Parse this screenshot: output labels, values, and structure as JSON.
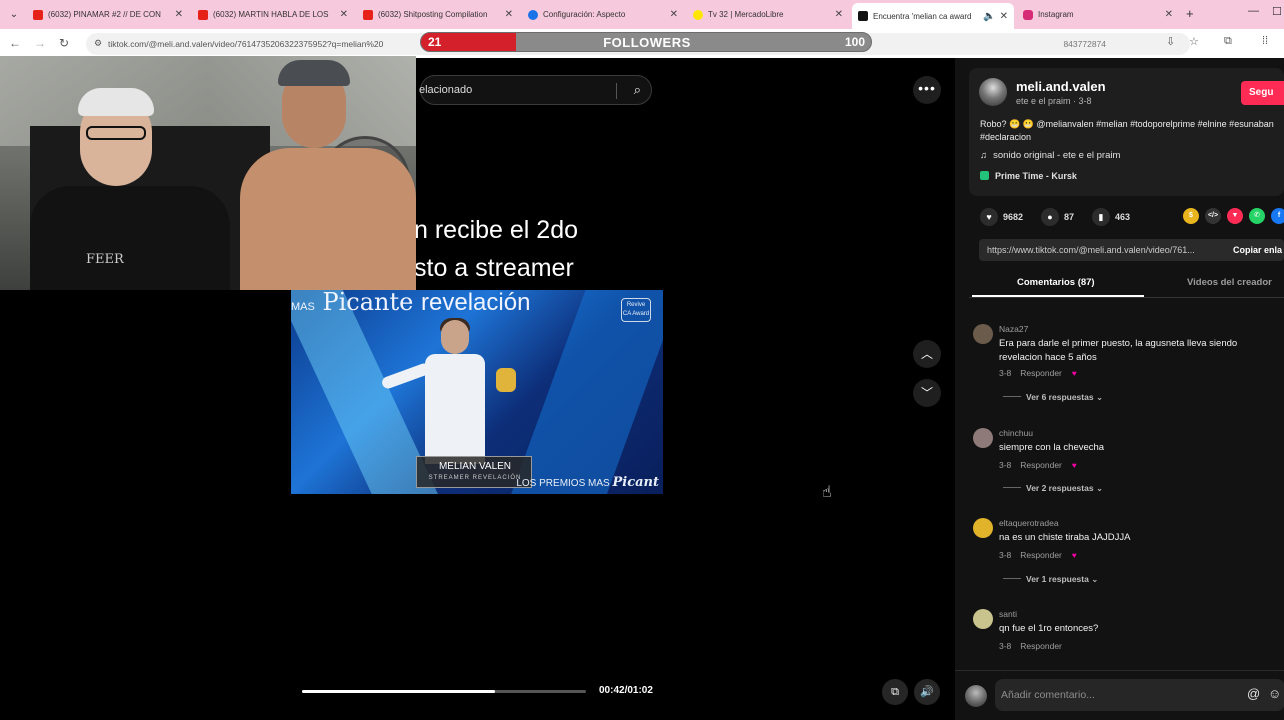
{
  "browser": {
    "tabs": [
      {
        "title": "(6032) PINAMAR #2 // DE CON",
        "icon": "youtube-icon",
        "color": "#e62117"
      },
      {
        "title": "(6032) MARTIN HABLA DE LOS",
        "icon": "youtube-icon",
        "color": "#e62117"
      },
      {
        "title": "(6032) Shitposting Compilation",
        "icon": "youtube-icon",
        "color": "#e62117"
      },
      {
        "title": "Configuración: Aspecto",
        "icon": "gear-icon",
        "color": "#1a73e8"
      },
      {
        "title": "Tv 32 | MercadoLibre",
        "icon": "mercadolibre-icon",
        "color": "#ffe600"
      },
      {
        "title": "Encuentra 'melian ca award",
        "icon": "tiktok-icon",
        "color": "#111111"
      },
      {
        "title": "Instagram",
        "icon": "instagram-icon",
        "color": "#d62976"
      }
    ],
    "url": "tiktok.com/@meli.and.valen/video/7614735206322375952?q=melian%20",
    "url_tail": "843772874"
  },
  "followers_bar": {
    "current": "21",
    "label": "FOLLOWERS",
    "goal": "100",
    "progress": 0.21
  },
  "search": {
    "query": "elacionado"
  },
  "video": {
    "caption_line1": "n recibe el 2do",
    "caption_line2": "sto a streamer",
    "caption_line3": "revelación",
    "clip_header_prefix": "MAS",
    "clip_header_main": "Picante",
    "clip_badge": "Revive CA Award",
    "clip_name": "MELIAN VALEN",
    "clip_name_sub": "STREAMER REVELACIÓN",
    "clip_footer_prefix": "LOS PREMIOS MAS",
    "clip_footer_brand": "Picant",
    "time": "00:42/01:02",
    "progress": 0.68
  },
  "webcam": {
    "shirt_text": "FEER"
  },
  "post": {
    "username": "meli.and.valen",
    "subtitle": "ete e el praim · 3-8",
    "follow_label": "Segu",
    "description": "Robo? 😬 😬 @melianvalen #melian #todoporelprime #elnine #esunaban #declaracion",
    "sound": "sonido original - ete e el praim",
    "music_tag": "Prime Time - Kursk",
    "likes": "9682",
    "comments": "87",
    "saves": "463",
    "link": "https://www.tiktok.com/@meli.and.valen/video/761...",
    "copy_label": "Copiar enla",
    "tab_comments": "Comentarios (87)",
    "tab_videos": "Videos del creador"
  },
  "comments": [
    {
      "user": "Naza27",
      "text": "Era para darle el primer puesto, la agusneta lleva siendo revelacion hace 5 años",
      "date": "3-8",
      "reply": "Responder",
      "view_replies": "Ver 6 respuestas",
      "avatar_color": "#6b5b4b"
    },
    {
      "user": "chinchuu",
      "text": "siempre con la chevecha",
      "date": "3-8",
      "reply": "Responder",
      "view_replies": "Ver 2 respuestas",
      "avatar_color": "#8f7a7a"
    },
    {
      "user": "eltaquerotradea",
      "text": "na es un chiste tiraba JAJDJJA",
      "date": "3-8",
      "reply": "Responder",
      "view_replies": "Ver 1 respuesta",
      "avatar_color": "#e0b32a"
    },
    {
      "user": "santi",
      "text": "qn fue el 1ro entonces?",
      "date": "3-8",
      "reply": "Responder",
      "view_replies": "",
      "avatar_color": "#c9c48e"
    }
  ],
  "comment_input": {
    "placeholder": "Añadir comentario..."
  }
}
